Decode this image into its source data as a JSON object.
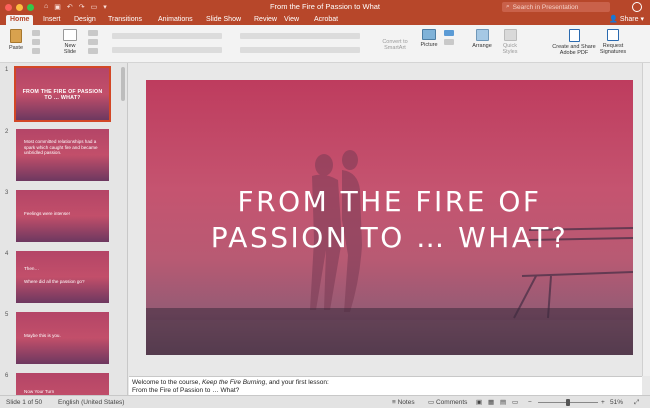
{
  "window": {
    "title": "From the Fire of Passion to What",
    "search_placeholder": "Search in Presentation"
  },
  "tabs": [
    "Home",
    "Insert",
    "Design",
    "Transitions",
    "Animations",
    "Slide Show",
    "Review",
    "View",
    "Acrobat"
  ],
  "share_label": "Share",
  "ribbon": {
    "paste": "Paste",
    "new_slide": "New Slide",
    "convert_smartart": "Convert to SmartArt",
    "picture": "Picture",
    "arrange": "Arrange",
    "quick_styles": "Quick Styles",
    "create_share_pdf": "Create and Share Adobe PDF",
    "request_signatures": "Request Signatures"
  },
  "thumbnails": [
    {
      "num": "1",
      "title": "FROM THE FIRE OF PASSION TO … WHAT?"
    },
    {
      "num": "2",
      "text": "Most committed relationships had a spark which caught fire and became unbridled passion."
    },
    {
      "num": "3",
      "text": "Feelings were intense!"
    },
    {
      "num": "4",
      "text": "Then…",
      "text2": "Where did all the passion go?"
    },
    {
      "num": "5",
      "text": "Maybe this is you."
    },
    {
      "num": "6",
      "text": "Now Your Turn"
    }
  ],
  "slide": {
    "line1": "FROM THE FIRE OF",
    "line2": "PASSION TO … WHAT?"
  },
  "notes": {
    "line1_pre": "Welcome to the course, ",
    "line1_em": "Keep the Fire Burning",
    "line1_post": ", and your first lesson:",
    "line2": "From the Fire of Passion to … What?"
  },
  "status": {
    "slide_of": "Slide 1 of 50",
    "language": "English (United States)",
    "notes": "Notes",
    "comments": "Comments",
    "zoom": "51%"
  },
  "colors": {
    "accent": "#b7472a",
    "selection": "#d24726"
  }
}
